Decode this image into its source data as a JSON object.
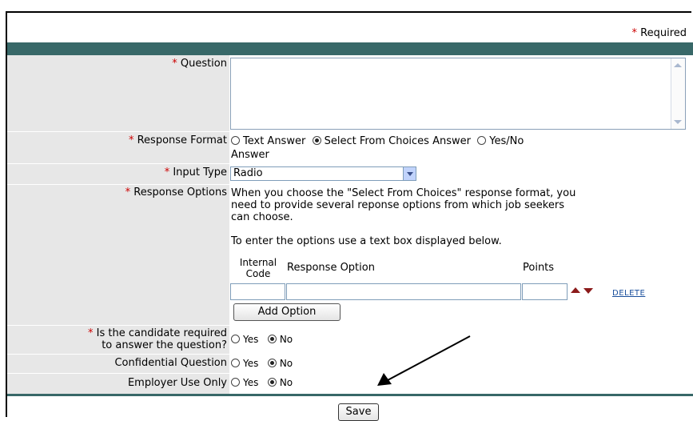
{
  "required_note": {
    "marker": "*",
    "text": "Required"
  },
  "fields": {
    "question": {
      "marker": "*",
      "label": "Question",
      "value": ""
    },
    "response_format": {
      "marker": "*",
      "label": "Response Format",
      "options": [
        "Text Answer",
        "Select From Choices Answer",
        "Yes/No",
        "Answer"
      ],
      "selected": "Select From Choices Answer"
    },
    "input_type": {
      "marker": "*",
      "label": "Input Type",
      "value": "Radio"
    },
    "response_options": {
      "marker": "*",
      "label": "Response Options",
      "help_line1": "When you choose the \"Select From Choices\" response format, you",
      "help_line2": "need to provide several reponse options from which job seekers",
      "help_line3": "can choose.",
      "help_line4": "To enter the options use a text box displayed below.",
      "col_internal_code_1": "Internal",
      "col_internal_code_2": "Code",
      "col_response_option": "Response Option",
      "col_points": "Points",
      "delete_label": "DELETE",
      "add_option_label": "Add Option"
    },
    "candidate_required": {
      "marker": "*",
      "label_line1": "Is the candidate required",
      "label_line2": "to answer the question?",
      "yes": "Yes",
      "no": "No",
      "selected": "No"
    },
    "confidential": {
      "label": "Confidential Question",
      "yes": "Yes",
      "no": "No",
      "selected": "No"
    },
    "employer_use": {
      "label": "Employer Use Only",
      "yes": "Yes",
      "no": "No",
      "selected": "No"
    }
  },
  "save_label": "Save",
  "colors": {
    "accent_bar": "#386868",
    "required_marker": "#cc0000",
    "label_bg": "#e7e7e7",
    "move_arrows": "#8b1a1a"
  },
  "icons": [
    "arrow-up-icon",
    "arrow-down-icon",
    "scroll-up-icon",
    "scroll-down-icon",
    "dropdown-arrow-icon",
    "pointer-arrow-annotation"
  ]
}
